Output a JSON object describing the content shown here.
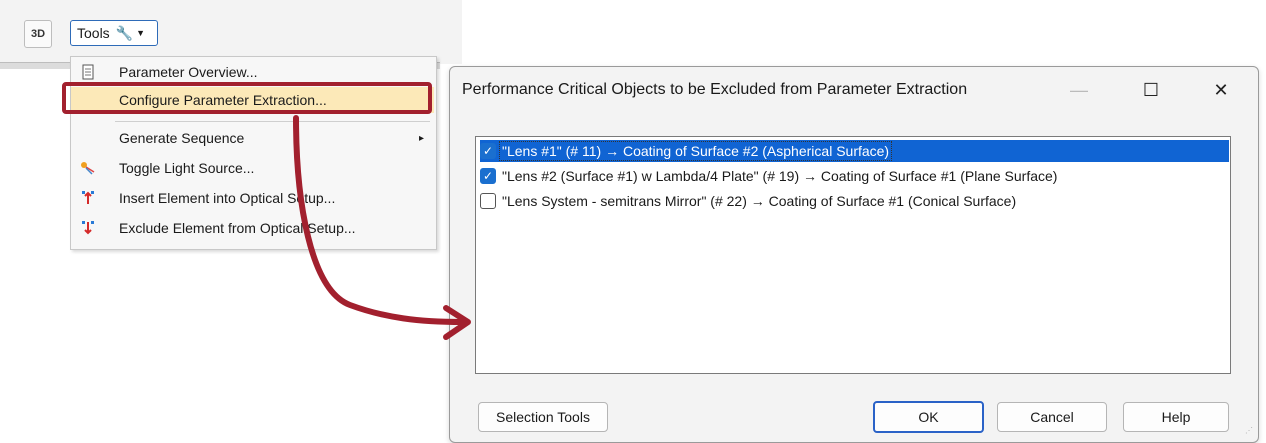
{
  "toolbar": {
    "btn3d_label": "3D",
    "tools_label": "Tools"
  },
  "menu": {
    "items": [
      {
        "label": "Parameter Overview...",
        "icon": "document-icon"
      },
      {
        "label": "Configure Parameter Extraction...",
        "icon": ""
      },
      {
        "label": "Generate Sequence",
        "icon": "",
        "submenu_arrow": "▸"
      },
      {
        "label": "Toggle Light Source...",
        "icon": "light-source-icon"
      },
      {
        "label": "Insert Element into Optical Setup...",
        "icon": "insert-element-icon"
      },
      {
        "label": "Exclude Element from Optical Setup...",
        "icon": "exclude-element-icon"
      }
    ]
  },
  "dialog": {
    "title": "Performance Critical Objects to be Excluded from Parameter Extraction",
    "window_controls": {
      "minimize": "—",
      "maximize": "☐",
      "close": "✕"
    },
    "list": [
      {
        "text": "\"Lens #1\" (# 11) → Coating of Surface #2 (Aspherical Surface)",
        "checked": true,
        "selected": true
      },
      {
        "text": "\"Lens #2 (Surface #1) w Lambda/4 Plate\" (# 19) → Coating of Surface #1 (Plane Surface)",
        "checked": true,
        "selected": false
      },
      {
        "text": "\"Lens System - semitrans Mirror\" (# 22) → Coating of Surface #1 (Conical Surface)",
        "checked": false,
        "selected": false
      }
    ],
    "buttons": {
      "selection_tools": "Selection Tools",
      "ok": "OK",
      "cancel": "Cancel",
      "help": "Help"
    }
  },
  "colors": {
    "highlight_frame": "#a2202e",
    "arrow": "#a2202e",
    "selection": "#1064d3",
    "checkbox": "#1a6fcf"
  }
}
